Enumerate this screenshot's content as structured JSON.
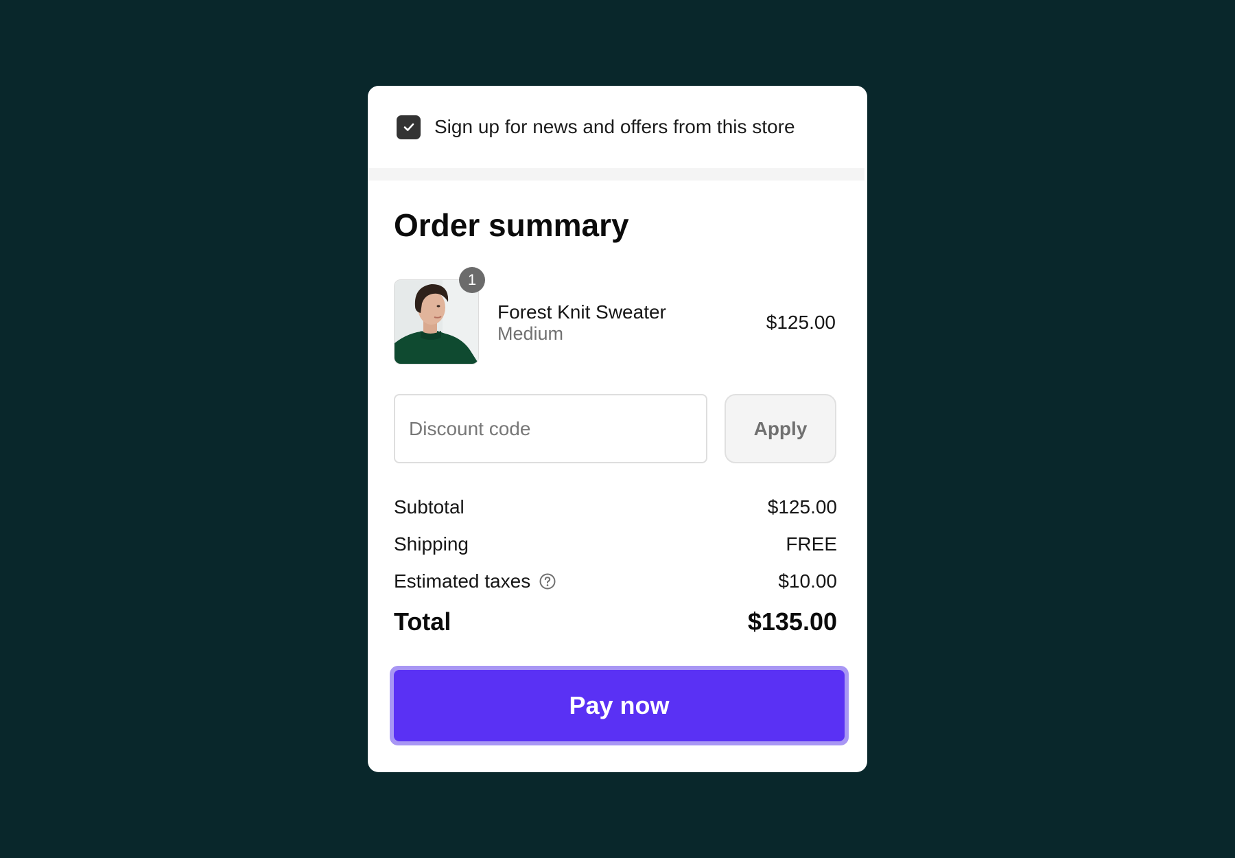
{
  "newsletter": {
    "checked": true,
    "label": "Sign up for news and offers from this store"
  },
  "summary": {
    "title": "Order summary"
  },
  "item": {
    "quantity": "1",
    "name": "Forest Knit Sweater",
    "variant": "Medium",
    "price": "$125.00",
    "image": "product-photo-woman-green-sweater"
  },
  "discount": {
    "placeholder": "Discount code",
    "value": "",
    "apply_label": "Apply"
  },
  "totals": {
    "subtotal_label": "Subtotal",
    "subtotal_value": "$125.00",
    "shipping_label": "Shipping",
    "shipping_value": "FREE",
    "taxes_label": "Estimated taxes",
    "taxes_value": "$10.00",
    "total_label": "Total",
    "total_value": "$135.00"
  },
  "pay": {
    "label": "Pay now"
  },
  "colors": {
    "page_background": "#09272b",
    "card_background": "#ffffff",
    "accent": "#5a31f4",
    "accent_focus_ring": "#a896f4",
    "checkbox": "#333333"
  },
  "icons": {
    "checkbox": "checkmark-icon",
    "taxes_help": "question-circle-icon"
  }
}
